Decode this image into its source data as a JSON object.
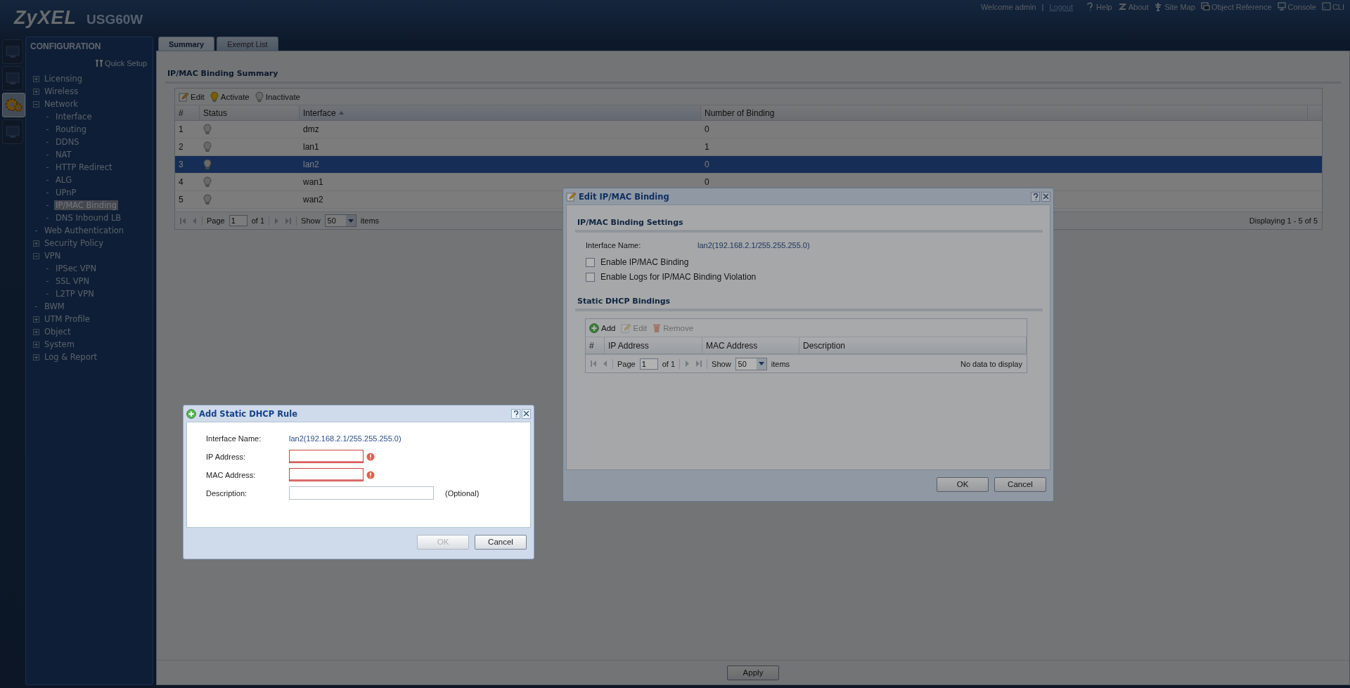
{
  "header": {
    "logo": "ZyXEL",
    "model": "USG60W",
    "welcome": "Welcome admin",
    "separator": "|",
    "logout": "Logout",
    "tools": [
      {
        "label": "Help"
      },
      {
        "label": "About"
      },
      {
        "label": "Site Map"
      },
      {
        "label": "Object Reference"
      },
      {
        "label": "Console"
      },
      {
        "label": "CLI"
      }
    ]
  },
  "nav_tabs": [
    {
      "selected": false
    },
    {
      "selected": false
    },
    {
      "selected": true
    },
    {
      "selected": false
    }
  ],
  "sidebar": {
    "title": "CONFIGURATION",
    "quick_setup": "Quick Setup",
    "tree": [
      {
        "label": "Licensing",
        "kind": "folder",
        "expanded": false,
        "selected": false
      },
      {
        "label": "Wireless",
        "kind": "folder",
        "expanded": false,
        "selected": false
      },
      {
        "label": "Network",
        "kind": "folder",
        "expanded": true,
        "selected": false,
        "children": [
          {
            "label": "Interface",
            "kind": "leaf",
            "selected": false
          },
          {
            "label": "Routing",
            "kind": "leaf",
            "selected": false
          },
          {
            "label": "DDNS",
            "kind": "leaf",
            "selected": false
          },
          {
            "label": "NAT",
            "kind": "leaf",
            "selected": false
          },
          {
            "label": "HTTP Redirect",
            "kind": "leaf",
            "selected": false
          },
          {
            "label": "ALG",
            "kind": "leaf",
            "selected": false
          },
          {
            "label": "UPnP",
            "kind": "leaf",
            "selected": false
          },
          {
            "label": "IP/MAC Binding",
            "kind": "leaf",
            "selected": true
          },
          {
            "label": "DNS Inbound LB",
            "kind": "leaf",
            "selected": false
          }
        ]
      },
      {
        "label": "Web Authentication",
        "kind": "leaf",
        "selected": false
      },
      {
        "label": "Security Policy",
        "kind": "folder",
        "expanded": false,
        "selected": false
      },
      {
        "label": "VPN",
        "kind": "folder",
        "expanded": true,
        "selected": false,
        "children": [
          {
            "label": "IPSec VPN",
            "kind": "leaf",
            "selected": false
          },
          {
            "label": "SSL VPN",
            "kind": "leaf",
            "selected": false
          },
          {
            "label": "L2TP VPN",
            "kind": "leaf",
            "selected": false
          }
        ]
      },
      {
        "label": "BWM",
        "kind": "leaf",
        "selected": false
      },
      {
        "label": "UTM Profile",
        "kind": "folder",
        "expanded": false,
        "selected": false
      },
      {
        "label": "Object",
        "kind": "folder",
        "expanded": false,
        "selected": false
      },
      {
        "label": "System",
        "kind": "folder",
        "expanded": false,
        "selected": false
      },
      {
        "label": "Log & Report",
        "kind": "folder",
        "expanded": false,
        "selected": false
      }
    ]
  },
  "tabs": [
    {
      "label": "Summary",
      "selected": true
    },
    {
      "label": "Exempt List",
      "selected": false
    }
  ],
  "summary": {
    "title": "IP/MAC Binding Summary",
    "toolbar": [
      {
        "label": "Edit",
        "kind": "edit"
      },
      {
        "label": "Activate",
        "kind": "activate"
      },
      {
        "label": "Inactivate",
        "kind": "inactivate"
      }
    ],
    "columns": [
      {
        "label": "#",
        "sorted_ascending": false
      },
      {
        "label": "Status",
        "sorted_ascending": false
      },
      {
        "label": "Interface",
        "sorted_ascending": true
      },
      {
        "label": "Number of Binding",
        "sorted_ascending": false
      }
    ],
    "rows": [
      {
        "num": "1",
        "active": false,
        "interface": "dmz",
        "bindings": "0",
        "selected": false
      },
      {
        "num": "2",
        "active": false,
        "interface": "lan1",
        "bindings": "1",
        "selected": false
      },
      {
        "num": "3",
        "active": false,
        "interface": "lan2",
        "bindings": "0",
        "selected": true
      },
      {
        "num": "4",
        "active": false,
        "interface": "wan1",
        "bindings": "0",
        "selected": false
      },
      {
        "num": "5",
        "active": false,
        "interface": "wan2",
        "selected": false
      }
    ],
    "pager": {
      "page_label": "Page",
      "page": "1",
      "of": "of 1",
      "show": "Show",
      "per_page": "50",
      "items": "items"
    },
    "displaying": "Displaying 1 - 5 of 5"
  },
  "apply": "Apply",
  "edit_dialog": {
    "title": "Edit IP/MAC Binding",
    "section1": "IP/MAC Binding Settings",
    "interface_label": "Interface Name:",
    "interface_value": "lan2(192.168.2.1/255.255.255.0)",
    "checkboxes": [
      {
        "label": "Enable IP/MAC Binding",
        "checked": false
      },
      {
        "label": "Enable Logs for IP/MAC Binding Violation",
        "checked": false
      }
    ],
    "section2": "Static DHCP Bindings",
    "toolbar": [
      {
        "label": "Add",
        "kind": "add",
        "disabled": false
      },
      {
        "label": "Edit",
        "kind": "edit",
        "disabled": true
      },
      {
        "label": "Remove",
        "kind": "remove",
        "disabled": true
      }
    ],
    "columns": [
      "#",
      "IP Address",
      "MAC Address",
      "Description"
    ],
    "pager": {
      "page_label": "Page",
      "page": "1",
      "of": "of 1",
      "show": "Show",
      "per_page": "50",
      "items": "items"
    },
    "empty": "No data to display",
    "buttons": [
      {
        "label": "OK",
        "disabled": false
      },
      {
        "label": "Cancel",
        "disabled": false
      }
    ]
  },
  "add_dialog": {
    "title": "Add Static DHCP Rule",
    "fields": [
      {
        "label": "Interface Name:",
        "kind": "text",
        "value": "lan2(192.168.2.1/255.255.255.0)"
      },
      {
        "label": "IP Address:",
        "kind": "field",
        "invalid": true
      },
      {
        "label": "MAC Address:",
        "kind": "field",
        "invalid": true
      },
      {
        "label": "Description:",
        "kind": "long_field",
        "invalid": false,
        "note": "(Optional)"
      }
    ],
    "buttons": [
      {
        "label": "OK",
        "disabled": true
      },
      {
        "label": "Cancel",
        "disabled": false
      }
    ]
  }
}
